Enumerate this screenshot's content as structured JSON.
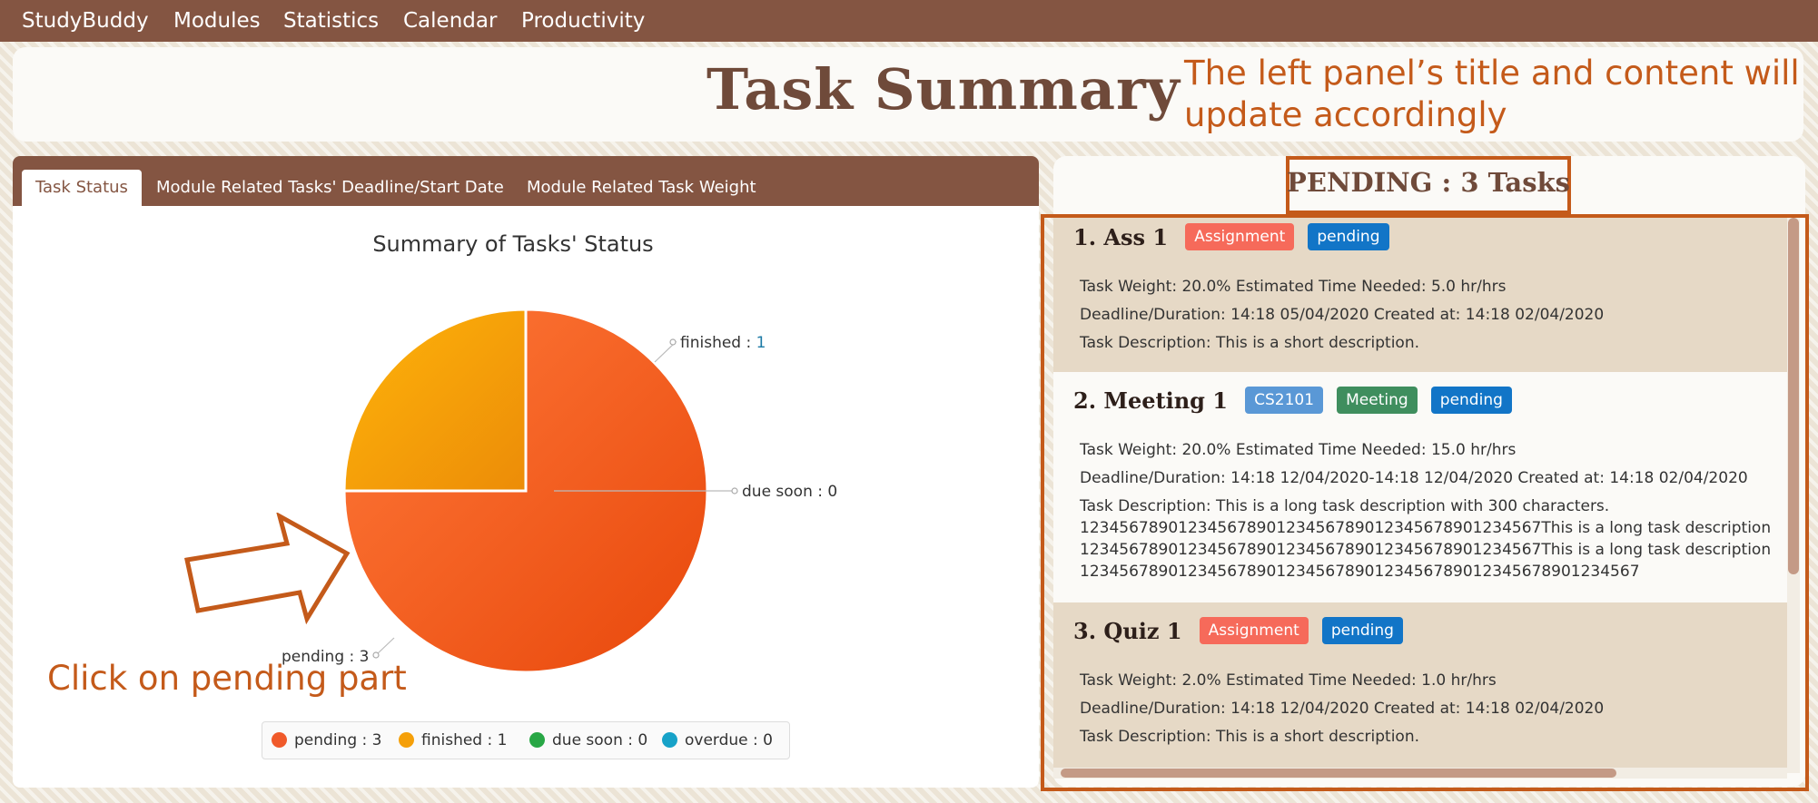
{
  "menu": [
    "StudyBuddy",
    "Modules",
    "Statistics",
    "Calendar",
    "Productivity"
  ],
  "header": {
    "title": "Task Summary"
  },
  "annotations": {
    "top_note_line1": "The left panel’s title and content will",
    "top_note_line2": "update accordingly",
    "bottom_note": "Click on pending part"
  },
  "tabs": [
    {
      "label": "Task Status",
      "active": true
    },
    {
      "label": "Module Related Tasks' Deadline/Start Date",
      "active": false
    },
    {
      "label": "Module Related Task Weight",
      "active": false
    }
  ],
  "chart_data": {
    "type": "pie",
    "title": "Summary of Tasks' Status",
    "slices": [
      {
        "name": "pending",
        "value": 3,
        "color": "#f05a2a"
      },
      {
        "name": "finished",
        "value": 1,
        "color": "#f5a009"
      },
      {
        "name": "due soon",
        "value": 0,
        "color": "#28a745"
      },
      {
        "name": "overdue",
        "value": 0,
        "color": "#17a2c8"
      }
    ],
    "slice_labels": [
      "pending : ",
      "3",
      "finished : ",
      "1",
      "due soon : 0"
    ],
    "legend": [
      "pending : 3",
      "finished : 1",
      "due soon : 0",
      "overdue : 0"
    ],
    "legend_placement": "bottom"
  },
  "right_panel": {
    "title": "PENDING : 3 Tasks",
    "tasks": [
      {
        "name": "1.  Ass 1",
        "tags": [
          {
            "label": "Assignment",
            "color": "#f66a5a"
          },
          {
            "label": "pending",
            "color": "#1275c7"
          }
        ],
        "lines": [
          "Task Weight: 20.0%   Estimated Time Needed: 5.0 hr/hrs",
          "Deadline/Duration: 14:18 05/04/2020   Created at: 14:18 02/04/2020",
          "Task Description: This is a short description."
        ]
      },
      {
        "name": "2.  Meeting 1",
        "tags": [
          {
            "label": "CS2101",
            "color": "#5a98d6"
          },
          {
            "label": "Meeting",
            "color": "#3f8e5e"
          },
          {
            "label": "pending",
            "color": "#1275c7"
          }
        ],
        "lines": [
          "Task Weight: 20.0%   Estimated Time Needed: 15.0 hr/hrs",
          "Deadline/Duration: 14:18 12/04/2020-14:18 12/04/2020   Created at: 14:18 02/04/2020",
          "Task Description: This is a long task description with 300 characters.",
          "12345678901234567890123456789012345678901234567This is a long task description",
          "12345678901234567890123456789012345678901234567This is a long task description",
          "123456789012345678901234567890123456789012345678901234567"
        ]
      },
      {
        "name": "3.  Quiz 1",
        "tags": [
          {
            "label": "Assignment",
            "color": "#f66a5a"
          },
          {
            "label": "pending",
            "color": "#1275c7"
          }
        ],
        "lines": [
          "Task Weight: 2.0%   Estimated Time Needed: 1.0 hr/hrs",
          "Deadline/Duration: 14:18 12/04/2020   Created at: 14:18 02/04/2020",
          "Task Description: This is a short description."
        ]
      }
    ]
  },
  "colors": {
    "menu_bar": "#845542",
    "accent_outline": "#c45a1a",
    "card_bg": "#e6d9c6"
  }
}
